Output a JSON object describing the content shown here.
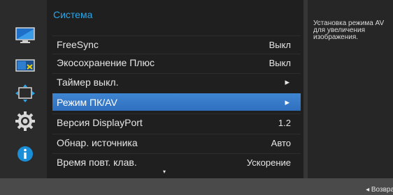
{
  "menu": {
    "title": "Система",
    "items": [
      {
        "label": "FreeSync",
        "value": "Выкл"
      },
      {
        "label": "Экосохранение Плюс",
        "value": "Выкл"
      },
      {
        "label": "Таймер выкл.",
        "value": "▸"
      },
      {
        "label": "Режим ПК/AV",
        "value": "▸",
        "selected": true
      },
      {
        "label": "Версия DisplayPort",
        "value": "1.2"
      },
      {
        "label": "Обнар. источника",
        "value": "Авто"
      },
      {
        "label": "Время повт. клав.",
        "value": "Ускорение"
      }
    ],
    "scroll_indicator": "▾"
  },
  "help": {
    "text": "Установка режима AV\nдля увеличения\nизображения."
  },
  "bottom_bar": {
    "return_label": "◂ Возвра"
  },
  "sidebar": {
    "icons": [
      "picture-monitor-icon",
      "screen-adjust-icon",
      "position-size-icon",
      "settings-gear-icon",
      "information-icon"
    ]
  },
  "colors": {
    "title_accent": "#2aa6e8",
    "selected_bg": "#3f86d2",
    "info_icon": "#1a8fd8"
  }
}
